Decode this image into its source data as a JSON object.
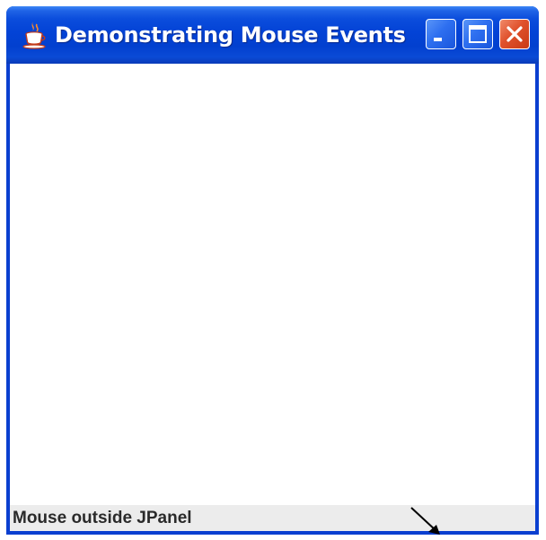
{
  "window": {
    "title": "Demonstrating Mouse Events",
    "app_icon": "java-coffee-cup-icon",
    "controls": {
      "minimize_icon": "minimize-icon",
      "maximize_icon": "maximize-icon",
      "close_icon": "close-icon"
    }
  },
  "status_bar": {
    "text": "Mouse outside JPanel"
  },
  "cursor": {
    "icon": "arrow-pointer-icon"
  },
  "colors": {
    "titlebar": "#0343d6",
    "close_button": "#e0512c",
    "status_bar": "#ececec",
    "content_background": "#ffffff"
  }
}
